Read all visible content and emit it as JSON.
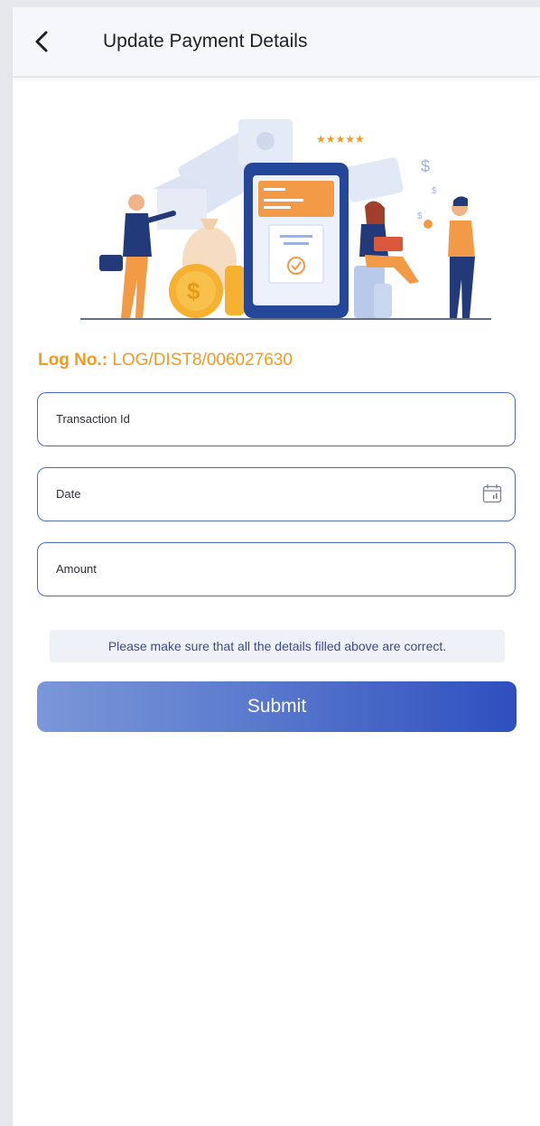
{
  "header": {
    "title": "Update Payment Details",
    "back_icon": "chevron-left-icon"
  },
  "log": {
    "label": "Log No.:",
    "value": "LOG/DIST8/006027630"
  },
  "form": {
    "transaction_id_placeholder": "Transaction Id",
    "date_placeholder": "Date",
    "amount_placeholder": "Amount",
    "date_icon": "calendar-icon"
  },
  "note": "Please make sure that all the details filled above are correct.",
  "submit_label": "Submit",
  "colors": {
    "accent_orange": "#f39a1f",
    "field_border": "#4e6cb8",
    "button_start": "#7c97d8",
    "button_end": "#2f4fc0"
  }
}
